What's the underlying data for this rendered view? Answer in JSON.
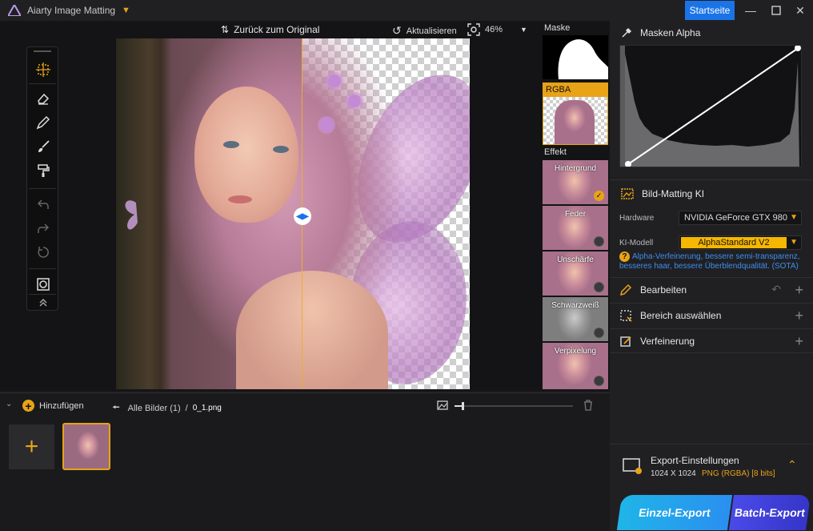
{
  "app": {
    "title": "Aiarty Image Matting",
    "home_button": "Startseite"
  },
  "canvas_bar": {
    "revert_label": "Zurück zum Original",
    "refresh_label": "Aktualisieren",
    "zoom": "46%"
  },
  "tools": [
    "select-move-icon",
    "eraser-icon",
    "brush-icon",
    "paint-brush-icon",
    "roller-icon",
    "undo-icon",
    "redo-icon",
    "reset-icon",
    "mask-view-icon",
    "collapse-icon"
  ],
  "thumbs": {
    "mask_label": "Maske",
    "rgba_label": "RGBA",
    "effect_label": "Effekt",
    "effects": [
      {
        "name": "Hintergrund",
        "active": true
      },
      {
        "name": "Feder",
        "active": false
      },
      {
        "name": "Unschärfe",
        "active": false
      },
      {
        "name": "Schwarzweiß",
        "active": false
      },
      {
        "name": "Verpixelung",
        "active": false
      }
    ]
  },
  "right": {
    "masks_alpha_title": "Masken Alpha",
    "matting_title": "Bild-Matting KI",
    "hardware_label": "Hardware",
    "hardware_value": "NVIDIA GeForce GTX 980",
    "model_label": "KI-Modell",
    "model_value": "AlphaStandard  V2",
    "model_hint": "Alpha-Verfeinerung, bessere semi-transparenz, besseres haar, bessere Überblendqualität. (SOTA)",
    "sections": [
      "Bearbeiten",
      "Bereich auswählen",
      "Verfeinerung"
    ],
    "export_title": "Export-Einstellungen",
    "export_size": "1024 X 1024",
    "export_format": "PNG (RGBA) [8 bits]",
    "single_export": "Einzel-Export",
    "batch_export": "Batch-Export"
  },
  "bottom": {
    "add_label": "Hinzufügen",
    "breadcrumb_all": "Alle Bilder (1)",
    "breadcrumb_sep": "/",
    "breadcrumb_file": "0_1.png"
  },
  "colors": {
    "accent": "#e8a317",
    "blue": "#1a74e8",
    "model_select": "#f5b700"
  }
}
